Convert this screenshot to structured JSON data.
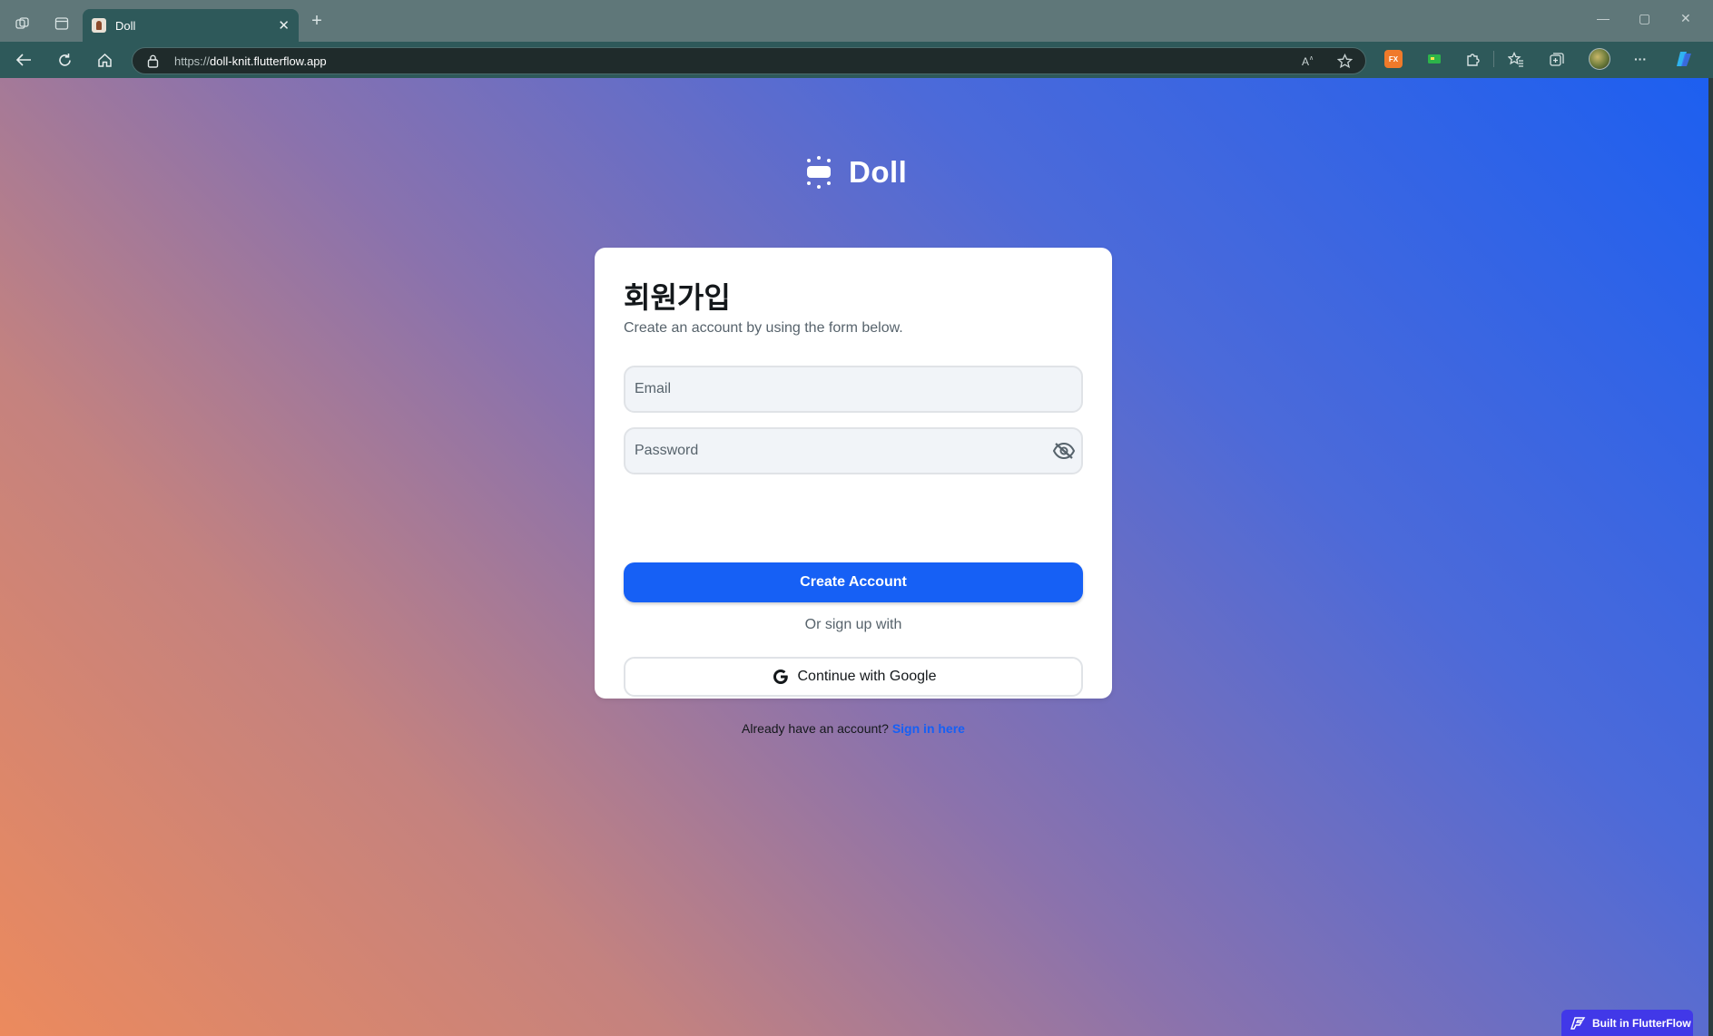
{
  "browser": {
    "tab_title": "Doll",
    "tab_close": "✕",
    "new_tab": "+",
    "url_scheme": "https://",
    "url_host": "doll-knit.flutterflow.app",
    "window_controls": [
      "—",
      "▢",
      "✕"
    ],
    "extensions": [
      {
        "name": "fx-extension",
        "label": "FX",
        "color": "#f07a2a"
      },
      {
        "name": "green-extension",
        "label": "",
        "color": "#2db34a"
      }
    ],
    "menu_more": "···"
  },
  "brand": {
    "name": "Doll"
  },
  "signup": {
    "heading": "회원가입",
    "subtitle": "Create an account by using the form below.",
    "email_placeholder": "Email",
    "password_placeholder": "Password",
    "create_button": "Create Account",
    "or_text": "Or sign up with",
    "google_button": "Continue with Google",
    "signin_prompt": "Already have an account? ",
    "signin_link": "Sign in here"
  },
  "badge": {
    "label": "Built in FlutterFlow"
  },
  "colors": {
    "primary": "#1660f5",
    "card": "#ffffff",
    "text": "#14181b",
    "secondary_text": "#57636c",
    "badge": "#4138e8"
  }
}
